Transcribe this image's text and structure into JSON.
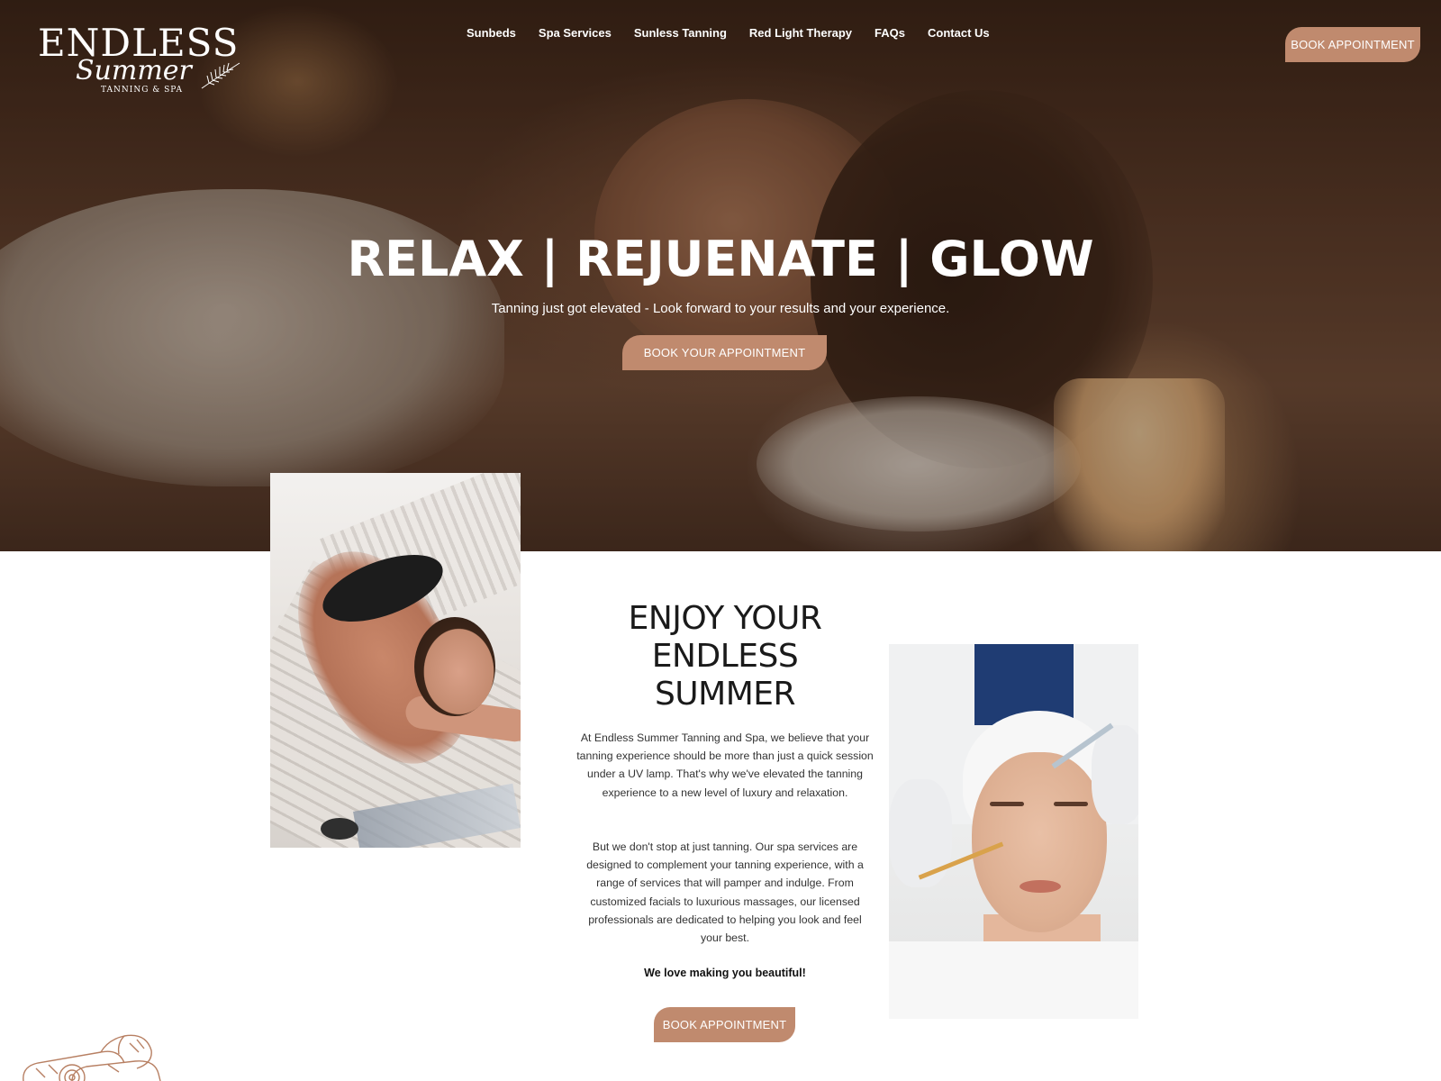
{
  "colors": {
    "accent": "#c08a6e",
    "text_dark": "#1a1a1a",
    "text_body": "#333333",
    "hero_text": "#ffffff"
  },
  "logo": {
    "word": "ENDLESS",
    "script": "Summer",
    "sub": "TANNING & SPA"
  },
  "nav": {
    "items": [
      {
        "label": "Sunbeds"
      },
      {
        "label": "Spa Services"
      },
      {
        "label": "Sunless Tanning"
      },
      {
        "label": "Red Light Therapy"
      },
      {
        "label": "FAQs"
      },
      {
        "label": "Contact Us"
      }
    ]
  },
  "header": {
    "cta_label": "BOOK APPOINTMENT"
  },
  "hero": {
    "title": "RELAX | REJUENATE | GLOW",
    "subtitle": "Tanning just got elevated - Look forward to your results and your experience.",
    "cta_label": "BOOK YOUR APPOINTMENT"
  },
  "about": {
    "title_lines": [
      "ENJOY YOUR",
      "ENDLESS",
      "SUMMER"
    ],
    "paragraph1": "At Endless Summer Tanning and Spa, we believe that your tanning experience should be more than just a quick session under a UV lamp. That's why we've elevated the tanning experience to a new level of luxury and relaxation.",
    "paragraph2": "But we don't stop at just tanning. Our spa services are designed to complement your tanning experience, with a range of services that will pamper and indulge. From customized facials to luxurious massages, our licensed professionals are dedicated to helping you look and feel your best.",
    "tagline": "We love making you beautiful!",
    "cta_label": "BOOK APPOINTMENT"
  },
  "icons": {
    "leaf": "palm-leaf-icon",
    "towels": "rolled-towels-illustration"
  }
}
